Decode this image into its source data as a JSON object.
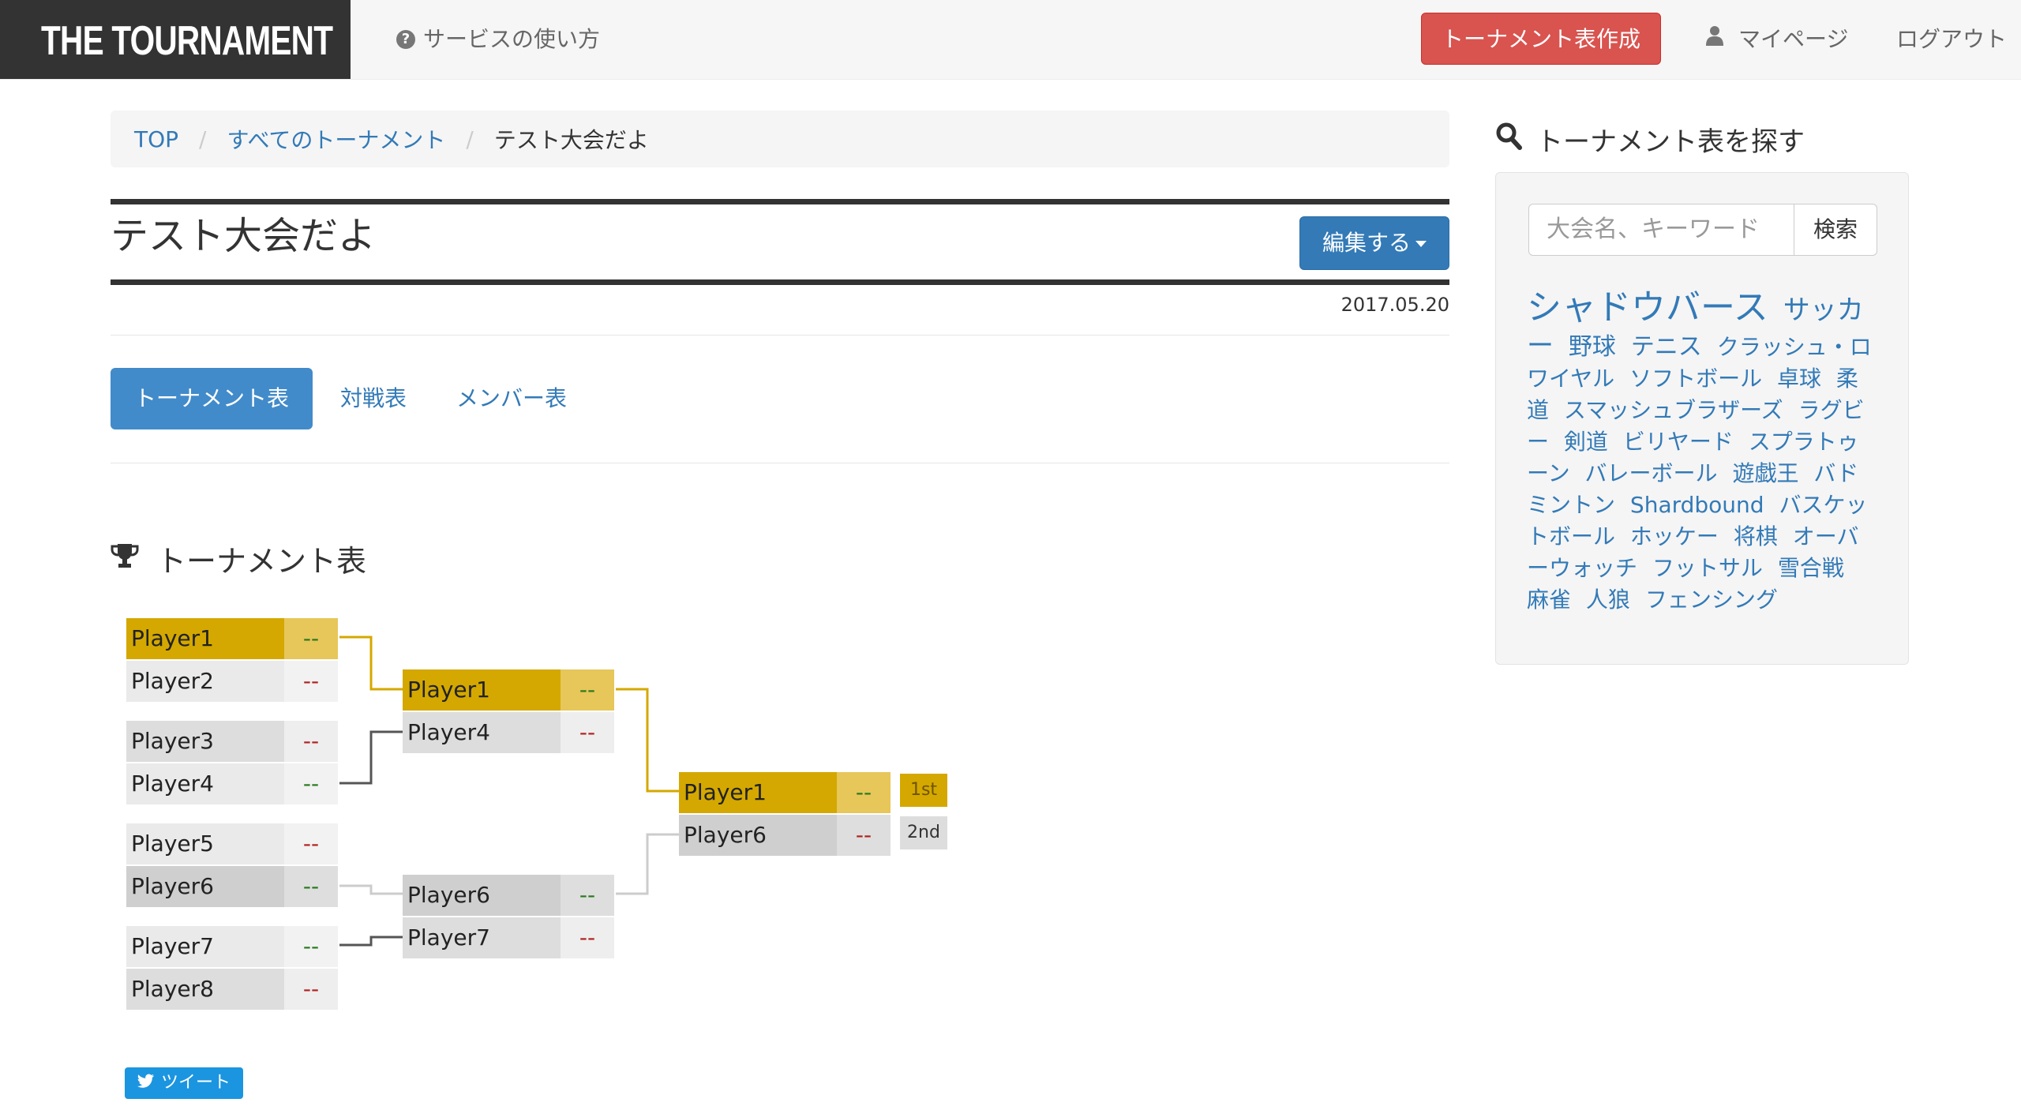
{
  "navbar": {
    "brand": "THE TOURNAMENT",
    "help": "サービスの使い方",
    "create_button": "トーナメント表作成",
    "mypage": "マイページ",
    "logout": "ログアウト"
  },
  "breadcrumb": {
    "items": [
      "TOP",
      "すべてのトーナメント",
      "テスト大会だよ"
    ],
    "separator": "/"
  },
  "page": {
    "title": "テスト大会だよ",
    "edit_button": "編集する",
    "date": "2017.05.20"
  },
  "tabs": [
    {
      "label": "トーナメント表",
      "active": true
    },
    {
      "label": "対戦表",
      "active": false
    },
    {
      "label": "メンバー表",
      "active": false
    }
  ],
  "bracket": {
    "heading": "トーナメント表",
    "round1": [
      {
        "name": "Player1",
        "score": "--"
      },
      {
        "name": "Player2",
        "score": "--"
      },
      {
        "name": "Player3",
        "score": "--"
      },
      {
        "name": "Player4",
        "score": "--"
      },
      {
        "name": "Player5",
        "score": "--"
      },
      {
        "name": "Player6",
        "score": "--"
      },
      {
        "name": "Player7",
        "score": "--"
      },
      {
        "name": "Player8",
        "score": "--"
      }
    ],
    "round2": [
      {
        "name": "Player1",
        "score": "--"
      },
      {
        "name": "Player4",
        "score": "--"
      },
      {
        "name": "Player6",
        "score": "--"
      },
      {
        "name": "Player7",
        "score": "--"
      }
    ],
    "final": [
      {
        "name": "Player1",
        "score": "--",
        "rank": "1st"
      },
      {
        "name": "Player6",
        "score": "--",
        "rank": "2nd"
      }
    ],
    "colors": {
      "winner": "#d4a800",
      "score_win": "#2a7a1e",
      "score_lose": "#b22222"
    }
  },
  "tweet": {
    "label": "ツイート"
  },
  "sidebar": {
    "heading": "トーナメント表を探す",
    "search_placeholder": "大会名、キーワード",
    "search_button": "検索",
    "tags": [
      "シャドウバース",
      "サッカー",
      "野球",
      "テニス",
      "クラッシュ・ロワイヤル",
      "ソフトボール",
      "卓球",
      "柔道",
      "スマッシュブラザーズ",
      "ラグビー",
      "剣道",
      "ビリヤード",
      "スプラトゥーン",
      "バレーボール",
      "遊戯王",
      "バドミントン",
      "Shardbound",
      "バスケットボール",
      "ホッケー",
      "将棋",
      "オーバーウォッチ",
      "フットサル",
      "雪合戦",
      "麻雀",
      "人狼",
      "フェンシング"
    ]
  }
}
